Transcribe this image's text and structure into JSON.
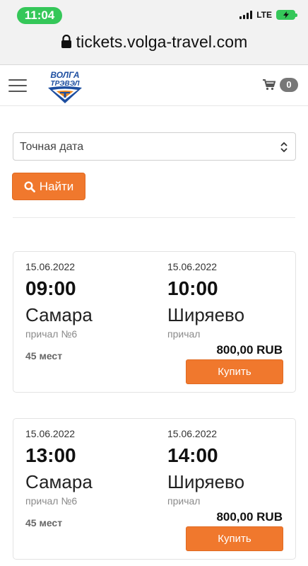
{
  "status_bar": {
    "time": "11:04",
    "network": "LTE",
    "battery": "charging"
  },
  "browser": {
    "url": "tickets.volga-travel.com",
    "lock_icon": "lock-icon"
  },
  "header": {
    "logo_text": [
      "ВОЛГА",
      "ТРЭВЭЛ"
    ],
    "cart_count": "0",
    "menu_icon": "hamburger-icon",
    "cart_icon": "cart-icon"
  },
  "filter": {
    "date_select_value": "Точная дата",
    "search_label": "Найти"
  },
  "colors": {
    "accent": "#f0782d",
    "status_green": "#35c759",
    "logo_blue": "#1d4ea0",
    "logo_orange": "#f08a1e"
  },
  "trips": [
    {
      "departure": {
        "date": "15.06.2022",
        "time": "09:00",
        "city": "Самара",
        "pier": "причал №6"
      },
      "arrival": {
        "date": "15.06.2022",
        "time": "10:00",
        "city": "Ширяево",
        "pier": "причал"
      },
      "seats": "45 мест",
      "price": "800,00 RUB",
      "buy_label": "Купить"
    },
    {
      "departure": {
        "date": "15.06.2022",
        "time": "13:00",
        "city": "Самара",
        "pier": "причал №6"
      },
      "arrival": {
        "date": "15.06.2022",
        "time": "14:00",
        "city": "Ширяево",
        "pier": "причал"
      },
      "seats": "45 мест",
      "price": "800,00 RUB",
      "buy_label": "Купить"
    }
  ]
}
